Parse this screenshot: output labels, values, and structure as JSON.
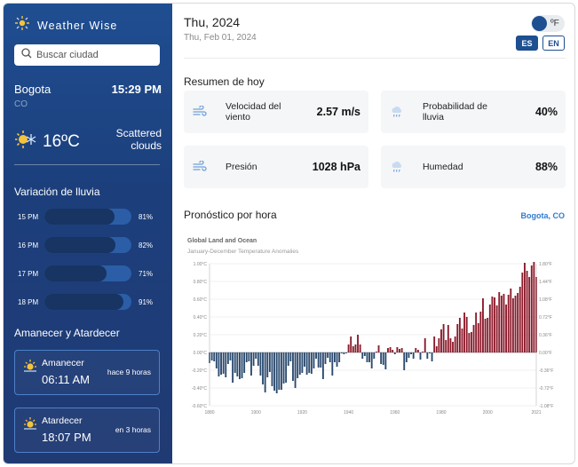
{
  "app": {
    "name": "Weather Wise"
  },
  "search": {
    "placeholder": "Buscar ciudad"
  },
  "location": {
    "city": "Bogota",
    "country": "CO",
    "time": "15:29 PM"
  },
  "current": {
    "temperature": "16ºC",
    "condition": "Scattered clouds"
  },
  "rain": {
    "title": "Variación de lluvia",
    "items": [
      {
        "hour": "15 PM",
        "percent": "81%",
        "value": 81
      },
      {
        "hour": "16 PM",
        "percent": "82%",
        "value": 82
      },
      {
        "hour": "17 PM",
        "percent": "71%",
        "value": 71
      },
      {
        "hour": "18 PM",
        "percent": "91%",
        "value": 91
      }
    ]
  },
  "sun": {
    "title": "Amanecer y Atardecer",
    "sunrise": {
      "label": "Amanecer",
      "time": "06:11 AM",
      "relative": "hace 9 horas"
    },
    "sunset": {
      "label": "Atardecer",
      "time": "18:07 PM",
      "relative": "en 3 horas"
    }
  },
  "header": {
    "date_title": "Thu, 2024",
    "date_full": "Thu, Feb 01, 2024",
    "unit_toggle": "ºF",
    "lang_es": "ES",
    "lang_en": "EN"
  },
  "summary": {
    "title": "Resumen de hoy",
    "wind": {
      "label": "Velocidad del viento",
      "value": "2.57 m/s",
      "icon": "wind-icon"
    },
    "rain_prob": {
      "label": "Probabilidad de lluvia",
      "value": "40%",
      "icon": "cloud-rain-icon"
    },
    "pressure": {
      "label": "Presión",
      "value": "1028 hPa",
      "icon": "wind-icon"
    },
    "humidity": {
      "label": "Humedad",
      "value": "88%",
      "icon": "cloud-rain-icon"
    }
  },
  "forecast": {
    "title": "Pronóstico por hora",
    "location_link": "Bogota, CO"
  },
  "colors": {
    "sidebar": "#1f4e91",
    "accent": "#1d4f91",
    "positive_bar": "#8b1a2b",
    "negative_bar": "#2b4a6f",
    "link": "#2f7bd3"
  },
  "chart_data": {
    "type": "bar",
    "title": "Global Land and Ocean",
    "subtitle": "January-December Temperature Anomalies",
    "x_ticks": [
      "1880",
      "1900",
      "1920",
      "1940",
      "1960",
      "1980",
      "2000",
      "2021"
    ],
    "y_left_ticks": [
      "1.00°C",
      "0.80°C",
      "0.60°C",
      "0.40°C",
      "0.20°C",
      "0.00°C",
      "-0.20°C",
      "-0.40°C",
      "-0.60°C"
    ],
    "y_right_ticks": [
      "1.80°F",
      "1.44°F",
      "1.08°F",
      "0.72°F",
      "0.36°F",
      "0.00°F",
      "-0.36°F",
      "-0.72°F",
      "-1.08°F"
    ],
    "ylim": [
      -0.6,
      1.0
    ],
    "xlim": [
      1880,
      2021
    ],
    "years": [
      1880,
      1881,
      1882,
      1883,
      1884,
      1885,
      1886,
      1887,
      1888,
      1889,
      1890,
      1891,
      1892,
      1893,
      1894,
      1895,
      1896,
      1897,
      1898,
      1899,
      1900,
      1901,
      1902,
      1903,
      1904,
      1905,
      1906,
      1907,
      1908,
      1909,
      1910,
      1911,
      1912,
      1913,
      1914,
      1915,
      1916,
      1917,
      1918,
      1919,
      1920,
      1921,
      1922,
      1923,
      1924,
      1925,
      1926,
      1927,
      1928,
      1929,
      1930,
      1931,
      1932,
      1933,
      1934,
      1935,
      1936,
      1937,
      1938,
      1939,
      1940,
      1941,
      1942,
      1943,
      1944,
      1945,
      1946,
      1947,
      1948,
      1949,
      1950,
      1951,
      1952,
      1953,
      1954,
      1955,
      1956,
      1957,
      1958,
      1959,
      1960,
      1961,
      1962,
      1963,
      1964,
      1965,
      1966,
      1967,
      1968,
      1969,
      1970,
      1971,
      1972,
      1973,
      1974,
      1975,
      1976,
      1977,
      1978,
      1979,
      1980,
      1981,
      1982,
      1983,
      1984,
      1985,
      1986,
      1987,
      1988,
      1989,
      1990,
      1991,
      1992,
      1993,
      1994,
      1995,
      1996,
      1997,
      1998,
      1999,
      2000,
      2001,
      2002,
      2003,
      2004,
      2005,
      2006,
      2007,
      2008,
      2009,
      2010,
      2011,
      2012,
      2013,
      2014,
      2015,
      2016,
      2017,
      2018,
      2019,
      2020,
      2021
    ],
    "values": [
      -0.12,
      -0.09,
      -0.1,
      -0.18,
      -0.27,
      -0.25,
      -0.24,
      -0.28,
      -0.13,
      -0.09,
      -0.34,
      -0.23,
      -0.27,
      -0.3,
      -0.29,
      -0.23,
      -0.11,
      -0.1,
      -0.26,
      -0.15,
      -0.07,
      -0.15,
      -0.26,
      -0.36,
      -0.45,
      -0.28,
      -0.22,
      -0.38,
      -0.43,
      -0.46,
      -0.42,
      -0.42,
      -0.35,
      -0.34,
      -0.15,
      -0.1,
      -0.32,
      -0.4,
      -0.29,
      -0.25,
      -0.23,
      -0.16,
      -0.25,
      -0.23,
      -0.24,
      -0.18,
      -0.07,
      -0.17,
      -0.17,
      -0.3,
      -0.13,
      -0.06,
      -0.11,
      -0.26,
      -0.11,
      -0.16,
      -0.11,
      -0.01,
      -0.02,
      -0.01,
      0.09,
      0.18,
      0.07,
      0.09,
      0.2,
      0.09,
      -0.07,
      -0.04,
      -0.11,
      -0.11,
      -0.18,
      -0.07,
      0.01,
      0.08,
      -0.13,
      -0.14,
      -0.19,
      0.05,
      0.06,
      0.03,
      -0.02,
      0.06,
      0.04,
      0.05,
      -0.2,
      -0.11,
      -0.06,
      -0.02,
      -0.07,
      0.05,
      0.03,
      -0.08,
      0.01,
      0.16,
      -0.07,
      -0.01,
      -0.1,
      0.18,
      0.07,
      0.16,
      0.26,
      0.32,
      0.14,
      0.31,
      0.16,
      0.12,
      0.18,
      0.32,
      0.39,
      0.27,
      0.45,
      0.4,
      0.22,
      0.23,
      0.31,
      0.45,
      0.33,
      0.46,
      0.61,
      0.38,
      0.39,
      0.54,
      0.63,
      0.62,
      0.53,
      0.68,
      0.64,
      0.66,
      0.54,
      0.65,
      0.72,
      0.61,
      0.64,
      0.67,
      0.74,
      0.9,
      1.01,
      0.92,
      0.85,
      0.98,
      1.02,
      0.85
    ],
    "grid": true,
    "xlabel": "",
    "ylabel": ""
  }
}
